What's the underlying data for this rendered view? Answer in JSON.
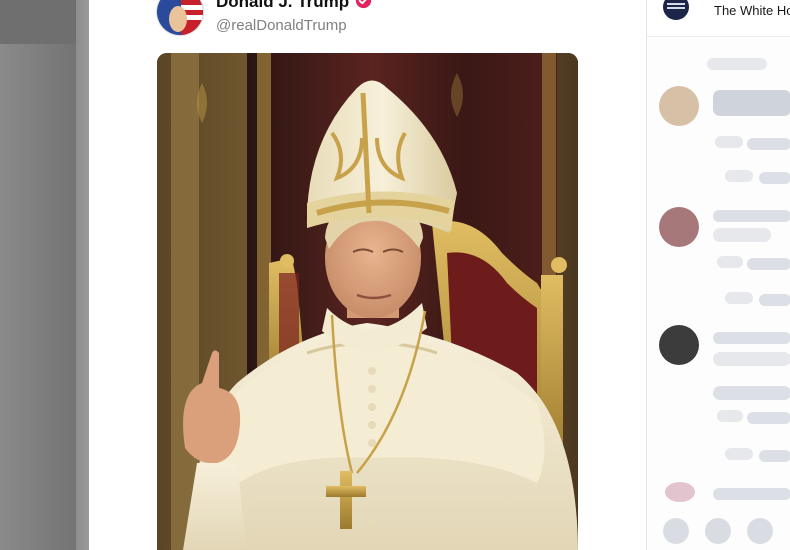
{
  "post": {
    "author": "Donald J. Trump",
    "handle": "@realDonaldTrump",
    "verified": true,
    "image_subject": "pope-portrait"
  },
  "side_panel": {
    "account_label": "The White Ho"
  },
  "colors": {
    "verified_badge": "#e0245e",
    "robe": "#efe6cc",
    "gold": "#c7a24a",
    "curtain": "#4a1e1c",
    "logo": "#1c2447"
  }
}
